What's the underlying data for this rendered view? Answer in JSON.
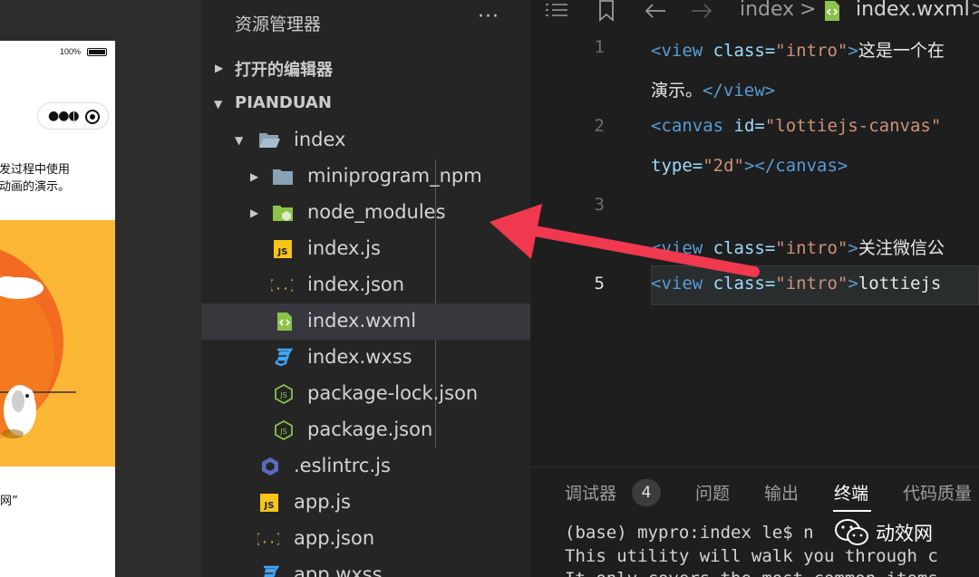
{
  "simulator": {
    "battery": "100%",
    "intro_line1": "发过程中使用",
    "intro_line2": "动画的演示。",
    "footer_text": "网”"
  },
  "explorer": {
    "title": "资源管理器",
    "more": "···",
    "open_editors": "打开的编辑器",
    "project": "PIANDUAN",
    "items": [
      {
        "label": "index",
        "icon": "folder-open-icon"
      },
      {
        "label": "miniprogram_npm",
        "icon": "folder-icon"
      },
      {
        "label": "node_modules",
        "icon": "node-folder-icon"
      },
      {
        "label": "index.js",
        "icon": "js-file-icon"
      },
      {
        "label": "index.json",
        "icon": "json-file-icon"
      },
      {
        "label": "index.wxml",
        "icon": "wxml-file-icon"
      },
      {
        "label": "index.wxss",
        "icon": "css-file-icon"
      },
      {
        "label": "package-lock.json",
        "icon": "node-json-icon"
      },
      {
        "label": "package.json",
        "icon": "node-json-icon"
      },
      {
        "label": ".eslintrc.js",
        "icon": "eslint-icon"
      },
      {
        "label": "app.js",
        "icon": "js-file-icon"
      },
      {
        "label": "app.json",
        "icon": "json-file-icon"
      },
      {
        "label": "app.wxss",
        "icon": "css-file-icon"
      }
    ]
  },
  "editor": {
    "breadcrumb": {
      "folder": "index",
      "file": "index.wxml",
      "sep": ">"
    },
    "line_numbers": [
      "1",
      "2",
      "3",
      "5"
    ],
    "code": {
      "l1a_tag_open": "<view ",
      "l1a_attr": "class=",
      "l1a_str": "\"intro\"",
      "l1a_tag_close": ">",
      "l1a_text": "这是一个在",
      "l1b_text": "演示。",
      "l1b_tag": "</view>",
      "l2a_tag_open": "<canvas ",
      "l2a_attr": "id=",
      "l2a_str": "\"lottiejs-canvas\"",
      "l2b_attr": "type=",
      "l2b_str": "\"2d\"",
      "l2b_tag": "></canvas>",
      "l4_tag_open": "<view ",
      "l4_attr": "class=",
      "l4_str": "\"intro\"",
      "l4_tag_close": ">",
      "l4_text": "关注微信公",
      "l5_tag_open": "<view ",
      "l5_attr": "class=",
      "l5_str": "\"intro\"",
      "l5_tag_close": ">",
      "l5_text": "lottiejs"
    }
  },
  "panel": {
    "tabs": [
      "调试器",
      "问题",
      "输出",
      "终端",
      "代码质量"
    ],
    "badge": "4",
    "terminal_lines": [
      "(base) mypro:index le$ n",
      "This utility will walk you through c",
      "It only covers the most common items"
    ]
  },
  "watermark": {
    "text": "动效网"
  }
}
